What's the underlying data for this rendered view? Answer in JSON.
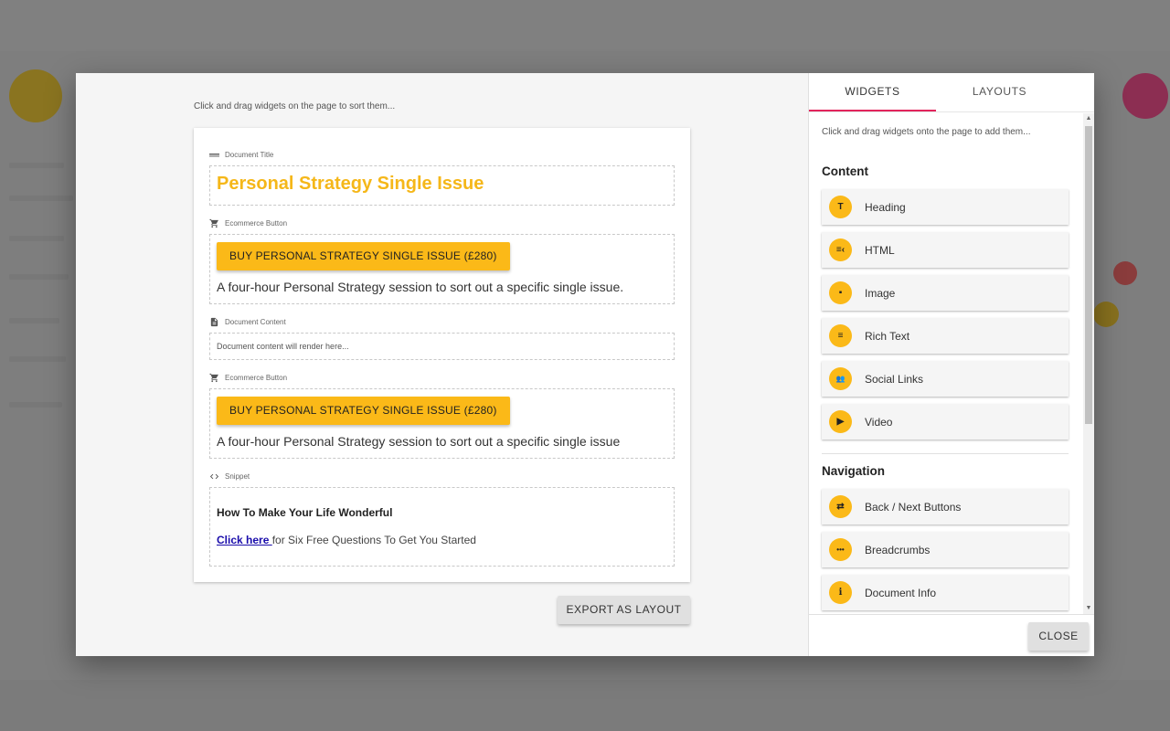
{
  "background": {
    "accent_yellow": "#fbb918",
    "accent_pink": "#e2245c"
  },
  "editor": {
    "hint": "Click and drag widgets on the page to sort them...",
    "widgets": {
      "document_title": {
        "label": "Document Title",
        "icon": "title-bar-icon",
        "value": "Personal Strategy Single Issue"
      },
      "ecommerce_1": {
        "label": "Ecommerce Button",
        "icon": "cart-icon",
        "button": "BUY PERSONAL STRATEGY SINGLE ISSUE (£280)",
        "description": "A four-hour Personal Strategy session to sort out a specific single issue."
      },
      "document_content": {
        "label": "Document Content",
        "icon": "document-icon",
        "placeholder": "Document content will render here..."
      },
      "ecommerce_2": {
        "label": "Ecommerce Button",
        "icon": "cart-icon",
        "button": "BUY PERSONAL STRATEGY SINGLE ISSUE (£280)",
        "description": "A four-hour Personal Strategy session to sort out a specific single issue"
      },
      "snippet": {
        "label": "Snippet",
        "icon": "code-icon",
        "heading": "How To Make Your Life Wonderful",
        "link_text": "Click here ",
        "link_suffix": "for Six Free Questions To Get You Started"
      }
    },
    "export_button": "EXPORT AS LAYOUT"
  },
  "sidebar": {
    "tabs": [
      {
        "label": "WIDGETS",
        "active": true
      },
      {
        "label": "LAYOUTS",
        "active": false
      }
    ],
    "hint": "Click and drag widgets onto the page to add them...",
    "sections": [
      {
        "title": "Content",
        "items": [
          {
            "label": "Heading",
            "icon": "heading-icon",
            "glyph": "T"
          },
          {
            "label": "HTML",
            "icon": "html-icon",
            "glyph": "≡‹"
          },
          {
            "label": "Image",
            "icon": "image-icon",
            "glyph": "▪"
          },
          {
            "label": "Rich Text",
            "icon": "rich-text-icon",
            "glyph": "≡"
          },
          {
            "label": "Social Links",
            "icon": "people-icon",
            "glyph": "👥"
          },
          {
            "label": "Video",
            "icon": "video-library-icon",
            "glyph": "▶"
          }
        ]
      },
      {
        "title": "Navigation",
        "items": [
          {
            "label": "Back / Next Buttons",
            "icon": "back-next-icon",
            "glyph": "⇄"
          },
          {
            "label": "Breadcrumbs",
            "icon": "breadcrumbs-icon",
            "glyph": "•••"
          },
          {
            "label": "Document Info",
            "icon": "info-icon",
            "glyph": "i"
          }
        ]
      }
    ],
    "close_button": "CLOSE"
  }
}
